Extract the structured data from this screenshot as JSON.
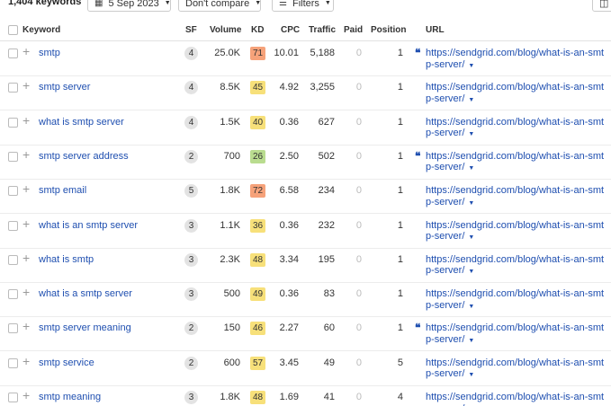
{
  "toolbar": {
    "keyword_count": "1,404 keywords",
    "date_label": "5 Sep 2023",
    "compare_label": "Don't compare",
    "filters_label": "Filters"
  },
  "columns": {
    "keyword": "Keyword",
    "sf": "SF",
    "volume": "Volume",
    "kd": "KD",
    "cpc": "CPC",
    "traffic": "Traffic",
    "paid": "Paid",
    "position": "Position",
    "url": "URL"
  },
  "kd_colors": {
    "orange": "#f6a27a",
    "yellow": "#f7e07a",
    "green": "#b9dc8f"
  },
  "rows": [
    {
      "keyword": "smtp",
      "sf": "4",
      "volume": "25.0K",
      "kd": "71",
      "kd_color": "#f6a27a",
      "cpc": "10.01",
      "traffic": "5,188",
      "paid": "0",
      "position": "1",
      "quote": true,
      "url": "https://sendgrid.com/blog/what-is-an-smtp-server/"
    },
    {
      "keyword": "smtp server",
      "sf": "4",
      "volume": "8.5K",
      "kd": "45",
      "kd_color": "#f7e07a",
      "cpc": "4.92",
      "traffic": "3,255",
      "paid": "0",
      "position": "1",
      "quote": false,
      "url": "https://sendgrid.com/blog/what-is-an-smtp-server/"
    },
    {
      "keyword": "what is smtp server",
      "sf": "4",
      "volume": "1.5K",
      "kd": "40",
      "kd_color": "#f7e07a",
      "cpc": "0.36",
      "traffic": "627",
      "paid": "0",
      "position": "1",
      "quote": false,
      "url": "https://sendgrid.com/blog/what-is-an-smtp-server/"
    },
    {
      "keyword": "smtp server address",
      "sf": "2",
      "volume": "700",
      "kd": "26",
      "kd_color": "#b9dc8f",
      "cpc": "2.50",
      "traffic": "502",
      "paid": "0",
      "position": "1",
      "quote": true,
      "url": "https://sendgrid.com/blog/what-is-an-smtp-server/"
    },
    {
      "keyword": "smtp email",
      "sf": "5",
      "volume": "1.8K",
      "kd": "72",
      "kd_color": "#f6a27a",
      "cpc": "6.58",
      "traffic": "234",
      "paid": "0",
      "position": "1",
      "quote": false,
      "url": "https://sendgrid.com/blog/what-is-an-smtp-server/"
    },
    {
      "keyword": "what is an smtp server",
      "sf": "3",
      "volume": "1.1K",
      "kd": "36",
      "kd_color": "#f7e07a",
      "cpc": "0.36",
      "traffic": "232",
      "paid": "0",
      "position": "1",
      "quote": false,
      "url": "https://sendgrid.com/blog/what-is-an-smtp-server/"
    },
    {
      "keyword": "what is smtp",
      "sf": "3",
      "volume": "2.3K",
      "kd": "48",
      "kd_color": "#f7e07a",
      "cpc": "3.34",
      "traffic": "195",
      "paid": "0",
      "position": "1",
      "quote": false,
      "url": "https://sendgrid.com/blog/what-is-an-smtp-server/"
    },
    {
      "keyword": "what is a smtp server",
      "sf": "3",
      "volume": "500",
      "kd": "49",
      "kd_color": "#f7e07a",
      "cpc": "0.36",
      "traffic": "83",
      "paid": "0",
      "position": "1",
      "quote": false,
      "url": "https://sendgrid.com/blog/what-is-an-smtp-server/"
    },
    {
      "keyword": "smtp server meaning",
      "sf": "2",
      "volume": "150",
      "kd": "46",
      "kd_color": "#f7e07a",
      "cpc": "2.27",
      "traffic": "60",
      "paid": "0",
      "position": "1",
      "quote": true,
      "url": "https://sendgrid.com/blog/what-is-an-smtp-server/"
    },
    {
      "keyword": "smtp service",
      "sf": "2",
      "volume": "600",
      "kd": "57",
      "kd_color": "#f7e07a",
      "cpc": "3.45",
      "traffic": "49",
      "paid": "0",
      "position": "5",
      "quote": false,
      "url": "https://sendgrid.com/blog/what-is-an-smtp-server/"
    },
    {
      "keyword": "smtp meaning",
      "sf": "3",
      "volume": "1.8K",
      "kd": "48",
      "kd_color": "#f7e07a",
      "cpc": "1.69",
      "traffic": "41",
      "paid": "0",
      "position": "4",
      "quote": false,
      "url": "https://sendgrid.com/blog/what-is-an-smtp-server/"
    }
  ]
}
